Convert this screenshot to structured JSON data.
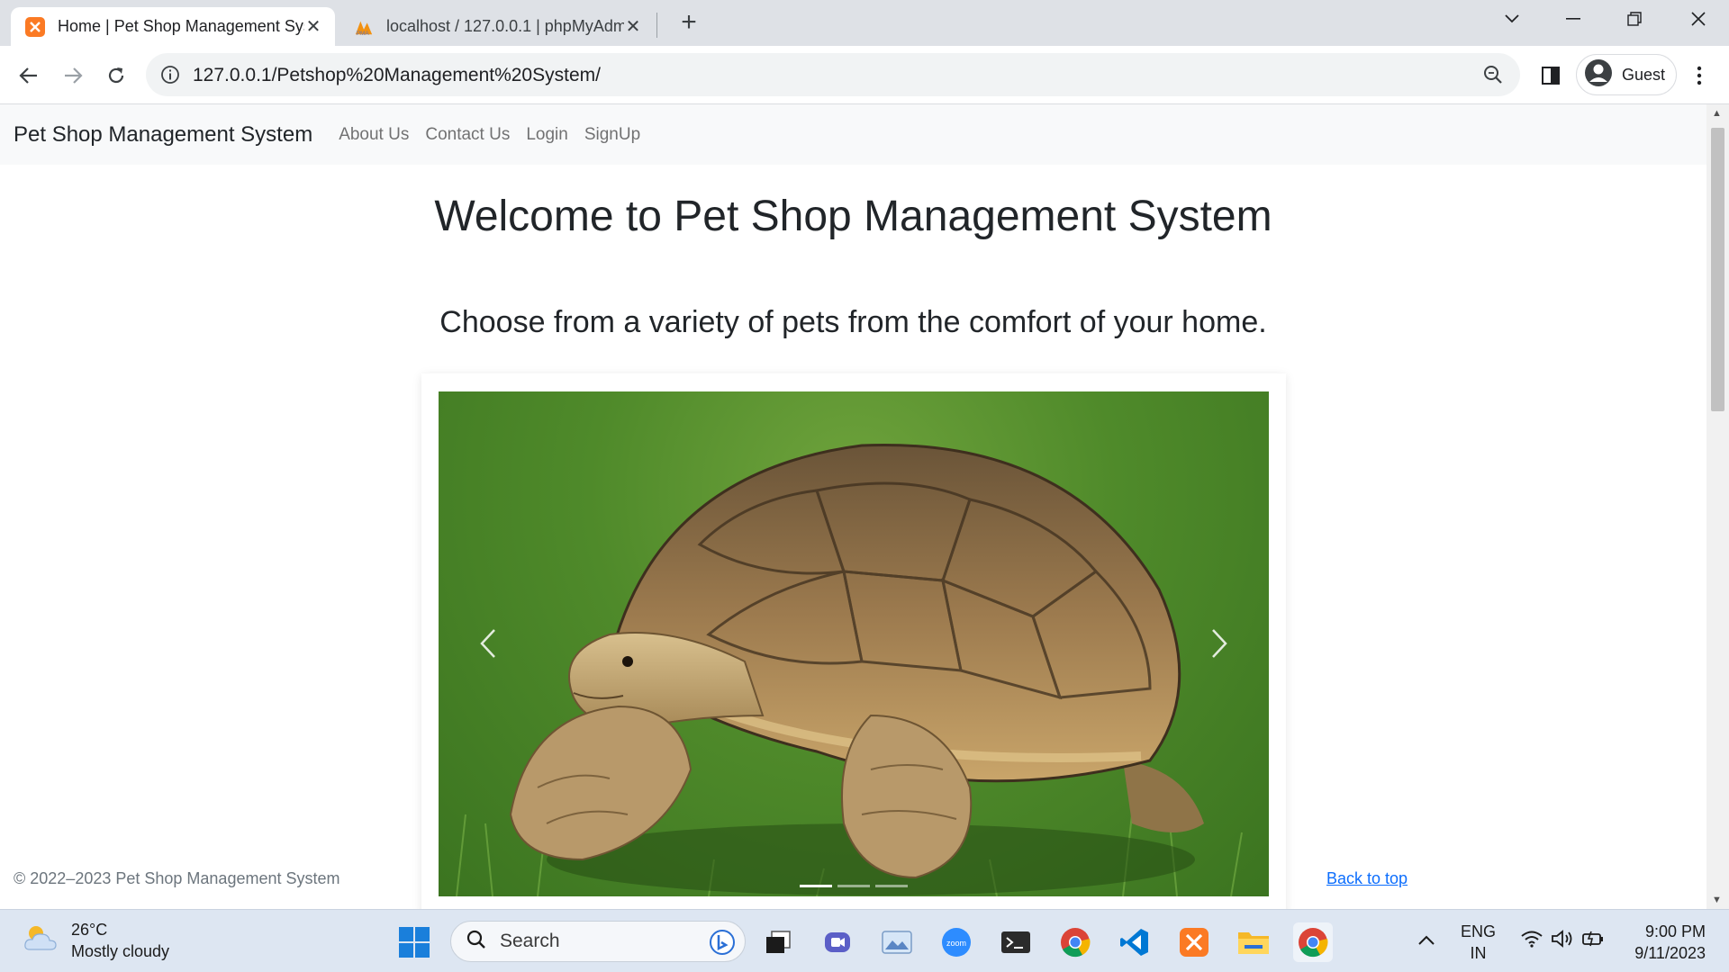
{
  "browser": {
    "tabs": [
      {
        "title": "Home | Pet Shop Management System",
        "favicon": "xampp-icon",
        "active": true
      },
      {
        "title": "localhost / 127.0.0.1 | phpMyAdmin",
        "favicon": "phpmyadmin-icon",
        "active": false
      }
    ],
    "url": "127.0.0.1/Petshop%20Management%20System/",
    "profile_label": "Guest"
  },
  "site": {
    "brand": "Pet Shop Management System",
    "nav": [
      "About Us",
      "Contact Us",
      "Login",
      "SignUp"
    ],
    "heading": "Welcome to Pet Shop Management System",
    "subheading": "Choose from a variety of pets from the comfort of your home.",
    "carousel": {
      "slide_count": 3,
      "active_index": 0,
      "image": "tortoise-photo"
    },
    "footer_copyright": "© 2022–2023 Pet Shop Management System",
    "back_to_top": "Back to top"
  },
  "taskbar": {
    "weather_temp": "26°C",
    "weather_desc": "Mostly cloudy",
    "search_label": "Search",
    "lang_top": "ENG",
    "lang_bottom": "IN",
    "time": "9:00 PM",
    "date": "9/11/2023"
  },
  "colors": {
    "link": "#0d6efd",
    "navbar_bg": "#f8f9fa",
    "xampp": "#fb7a24"
  }
}
